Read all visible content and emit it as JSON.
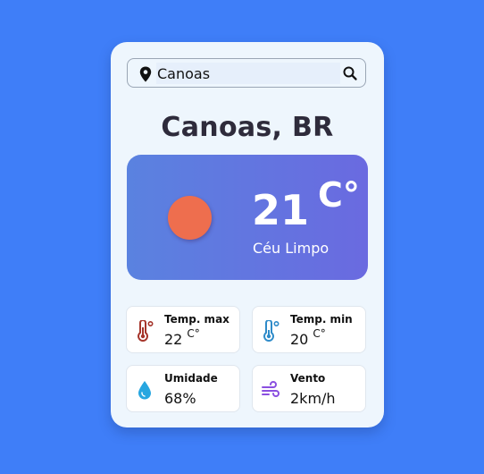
{
  "search": {
    "value": "Canoas"
  },
  "location": {
    "title": "Canoas, BR"
  },
  "current": {
    "temp": "21",
    "unit": "C°",
    "description": "Céu Limpo",
    "sun_color": "#ee6e4e"
  },
  "stats": {
    "max": {
      "label": "Temp. max",
      "value": "22",
      "unit": "C°",
      "icon": "thermometer-hot-icon",
      "color": "#a5342a"
    },
    "min": {
      "label": "Temp. min",
      "value": "20",
      "unit": "C°",
      "icon": "thermometer-cold-icon",
      "color": "#2e8bc9"
    },
    "humidity": {
      "label": "Umidade",
      "value": "68%",
      "icon": "water-drop-icon",
      "color": "#27a6e0"
    },
    "wind": {
      "label": "Vento",
      "value": "2km/h",
      "icon": "wind-icon",
      "color": "#8a4fe0"
    }
  }
}
